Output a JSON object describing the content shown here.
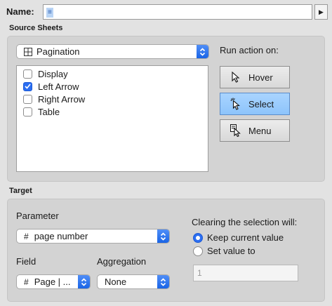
{
  "name": {
    "label": "Name:",
    "value": "≡",
    "arrow": "▶"
  },
  "source_sheets": {
    "title": "Source Sheets",
    "dashboard_select": {
      "icon": "grid-icon",
      "value": "Pagination"
    },
    "sheets": [
      {
        "label": "Display",
        "checked": false
      },
      {
        "label": "Left Arrow",
        "checked": true
      },
      {
        "label": "Right Arrow",
        "checked": false
      },
      {
        "label": "Table",
        "checked": false
      }
    ],
    "run_action": {
      "title": "Run action on:",
      "buttons": [
        {
          "label": "Hover",
          "icon": "cursor-icon",
          "selected": false
        },
        {
          "label": "Select",
          "icon": "select-cursor-icon",
          "selected": true
        },
        {
          "label": "Menu",
          "icon": "menu-cursor-icon",
          "selected": false
        }
      ]
    }
  },
  "target": {
    "title": "Target",
    "parameter_label": "Parameter",
    "parameter_select": {
      "icon": "#",
      "value": "page number"
    },
    "field_label": "Field",
    "field_select": {
      "icon": "#",
      "value": "Page | ..."
    },
    "aggregation_label": "Aggregation",
    "aggregation_select": {
      "value": "None"
    },
    "clearing": {
      "title": "Clearing the selection will:",
      "options": [
        {
          "label": "Keep current value",
          "selected": true
        },
        {
          "label": "Set value to",
          "selected": false
        }
      ],
      "value_placeholder": "1"
    }
  },
  "colors": {
    "accent": "#2b6ef2",
    "selected_button": "#9bcbfd",
    "panel": "#d3d3d3"
  }
}
